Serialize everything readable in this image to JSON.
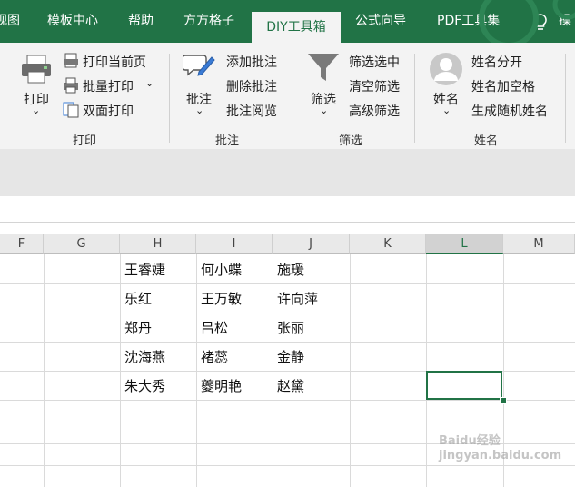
{
  "tabs": [
    {
      "label": "视图"
    },
    {
      "label": "模板中心"
    },
    {
      "label": "帮助"
    },
    {
      "label": "方方格子"
    },
    {
      "label": "DIY工具箱"
    },
    {
      "label": "公式向导"
    },
    {
      "label": "PDF工具集"
    },
    {
      "label": "操"
    }
  ],
  "active_tab": "DIY工具箱",
  "ribbon": {
    "print_group": {
      "big_button": "打印",
      "items": [
        "打印当前页",
        "批量打印",
        "双面打印"
      ],
      "label": "打印"
    },
    "comment_group": {
      "big_button": "批注",
      "items": [
        "添加批注",
        "删除批注",
        "批注阅览"
      ],
      "label": "批注"
    },
    "filter_group": {
      "big_button": "筛选",
      "items": [
        "筛选选中",
        "清空筛选",
        "高级筛选"
      ],
      "label": "筛选"
    },
    "name_group": {
      "big_button": "姓名",
      "items": [
        "姓名分开",
        "姓名加空格",
        "生成随机姓名"
      ],
      "label": "姓名"
    }
  },
  "columns": [
    "F",
    "G",
    "H",
    "I",
    "J",
    "K",
    "L",
    "M"
  ],
  "selected_column": "L",
  "rows": [
    [
      "王睿婕",
      "何小蝶",
      "施瑗"
    ],
    [
      "乐红",
      "王万敏",
      "许向萍"
    ],
    [
      "郑丹",
      "吕松",
      "张丽"
    ],
    [
      "沈海燕",
      "褚蕊",
      "金静"
    ],
    [
      "朱大秀",
      "夔明艳",
      "赵黛"
    ]
  ],
  "watermark": "Baidu经验 jingyan.baidu.com",
  "colors": {
    "accent": "#217346",
    "ribbon_bg": "#f3f3f3"
  }
}
